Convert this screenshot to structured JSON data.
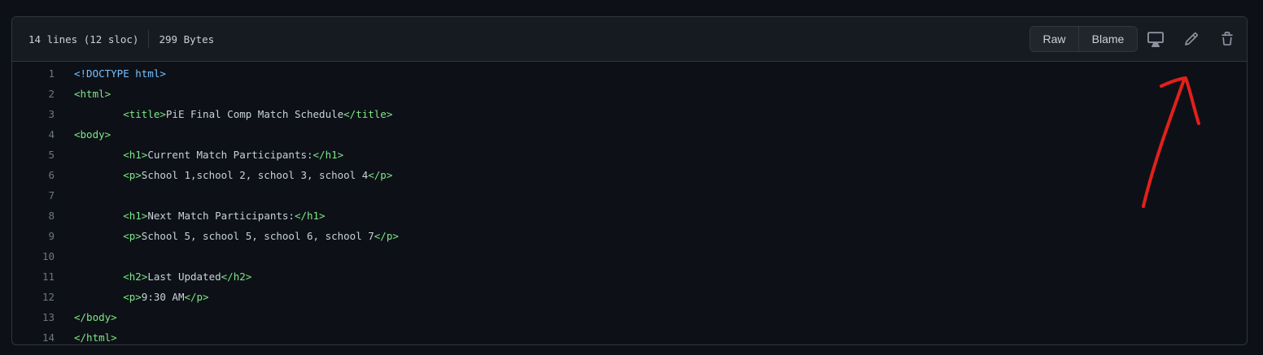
{
  "file_header": {
    "lines_info": "14 lines (12 sloc)",
    "size_info": "299 Bytes",
    "raw_label": "Raw",
    "blame_label": "Blame",
    "icons": [
      "desktop-icon",
      "pencil-icon",
      "trash-icon"
    ]
  },
  "colors": {
    "background": "#0d1117",
    "header_bg": "#161b22",
    "border": "#30363d",
    "tag": "#7ee787",
    "doctype": "#79c0ff",
    "text": "#c9d1d9",
    "line_number": "#6e7681",
    "annotation_arrow": "#e3201b"
  },
  "code_lines": [
    {
      "number": "1",
      "indent": "",
      "open": "<!DOCTYPE html>",
      "text": "",
      "close": "",
      "kind": "doctype"
    },
    {
      "number": "2",
      "indent": "",
      "open": "<html>",
      "text": "",
      "close": "",
      "kind": "tag"
    },
    {
      "number": "3",
      "indent": "        ",
      "open": "<title>",
      "text": "PiE Final Comp Match Schedule",
      "close": "</title>",
      "kind": "tag"
    },
    {
      "number": "4",
      "indent": "",
      "open": "<body>",
      "text": "",
      "close": "",
      "kind": "tag"
    },
    {
      "number": "5",
      "indent": "        ",
      "open": "<h1>",
      "text": "Current Match Participants:",
      "close": "</h1>",
      "kind": "tag"
    },
    {
      "number": "6",
      "indent": "        ",
      "open": "<p>",
      "text": "School 1,school 2, school 3, school 4",
      "close": "</p>",
      "kind": "tag"
    },
    {
      "number": "7",
      "indent": "",
      "open": "",
      "text": "",
      "close": "",
      "kind": "blank"
    },
    {
      "number": "8",
      "indent": "        ",
      "open": "<h1>",
      "text": "Next Match Participants:",
      "close": "</h1>",
      "kind": "tag"
    },
    {
      "number": "9",
      "indent": "        ",
      "open": "<p>",
      "text": "School 5, school 5, school 6, school 7",
      "close": "</p>",
      "kind": "tag"
    },
    {
      "number": "10",
      "indent": "",
      "open": "",
      "text": "",
      "close": "",
      "kind": "blank"
    },
    {
      "number": "11",
      "indent": "        ",
      "open": "<h2>",
      "text": "Last Updated",
      "close": "</h2>",
      "kind": "tag"
    },
    {
      "number": "12",
      "indent": "        ",
      "open": "<p>",
      "text": "9:30 AM",
      "close": "</p>",
      "kind": "tag"
    },
    {
      "number": "13",
      "indent": "",
      "open": "</body>",
      "text": "",
      "close": "",
      "kind": "tag"
    },
    {
      "number": "14",
      "indent": "",
      "open": "</html>",
      "text": "",
      "close": "",
      "kind": "tag"
    }
  ]
}
